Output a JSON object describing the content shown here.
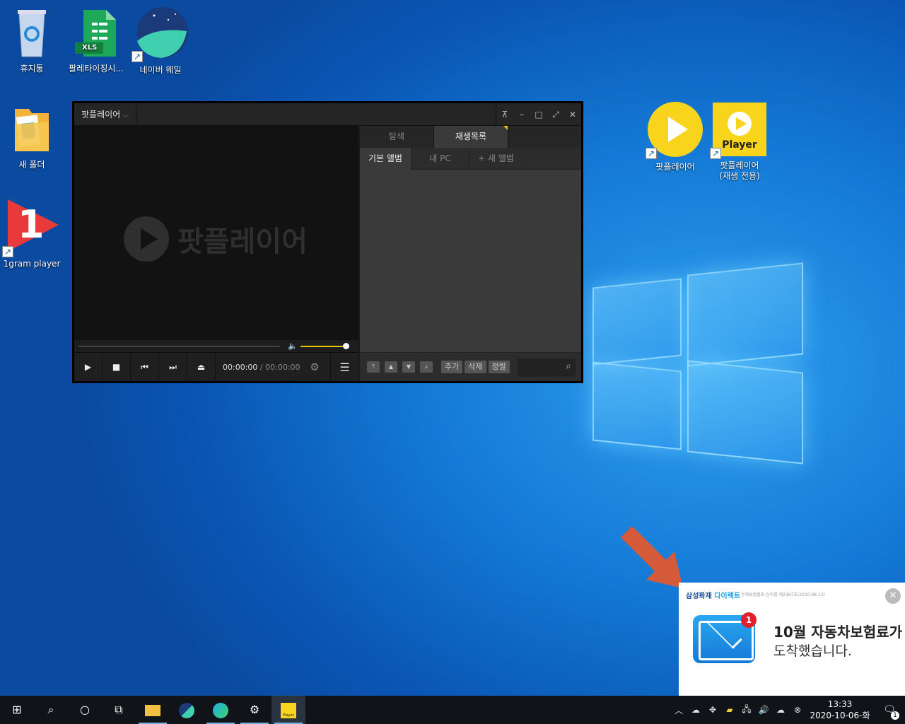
{
  "desktop": {
    "icons": [
      {
        "label": "휴지통",
        "icon": "recycle-bin-icon"
      },
      {
        "label": "팔레타이징시...",
        "icon": "xls-file-icon",
        "badge": "XLS"
      },
      {
        "label": "네이버 웨일",
        "icon": "naver-whale-icon"
      },
      {
        "label": "새 폴더",
        "icon": "folder-icon"
      },
      {
        "label": "1gram player",
        "icon": "1gram-player-icon",
        "mark": "1"
      },
      {
        "label": "팟플레이어",
        "icon": "potplayer-icon"
      },
      {
        "label": "팟플레이어\n(재생 전용)",
        "icon": "potplayer-play-only-icon",
        "mark": "Player"
      }
    ]
  },
  "player": {
    "app_name": "팟플레이어",
    "watermark": "팟플레이어",
    "time_current": "00:00:00",
    "time_separator": "/",
    "time_total": "00:00:00",
    "volume_level": 0.85,
    "tabs": [
      "탐색",
      "재생목록"
    ],
    "active_tab": "재생목록",
    "subtabs": [
      "기본 앨범",
      "내 PC",
      "+ 새 앨범"
    ],
    "active_subtab": "기본 앨범",
    "buttons": {
      "add": "추가",
      "delete": "삭제",
      "sort": "정렬"
    }
  },
  "notification": {
    "brand": "삼성화재",
    "brand_suffix": "다이렉트",
    "fine_print": "손해보험협회 심의필 제2367호(2020.08.13)",
    "badge": "1",
    "line1": "10월 자동차보험료가",
    "line2": "도착했습니다."
  },
  "taskbar": {
    "clock_time": "13:33",
    "clock_date": "2020-10-06-화",
    "notification_count": "1",
    "player_label": "Player"
  },
  "colors": {
    "accent": "#f0c800",
    "arrow": "#d45a3a",
    "notif_badge": "#e0202a"
  }
}
